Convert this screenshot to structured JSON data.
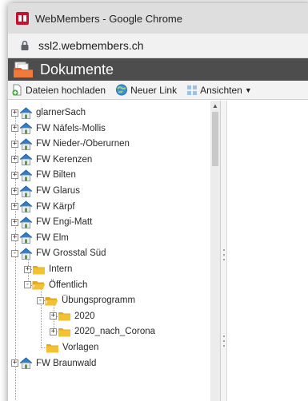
{
  "browser": {
    "window_title": "WebMembers - Google Chrome",
    "url": "ssl2.webmembers.ch"
  },
  "page": {
    "heading": "Dokumente"
  },
  "toolbar": {
    "upload_label": "Dateien hochladen",
    "new_link_label": "Neuer Link",
    "views_label": "Ansichten"
  },
  "tree": {
    "items": [
      {
        "label": "glarnerSach",
        "type": "house",
        "expander": "+"
      },
      {
        "label": "FW Näfels-Mollis",
        "type": "house",
        "expander": "+"
      },
      {
        "label": "FW Nieder-/Oberurnen",
        "type": "house",
        "expander": "+"
      },
      {
        "label": "FW Kerenzen",
        "type": "house",
        "expander": "+"
      },
      {
        "label": "FW Bilten",
        "type": "house",
        "expander": "+"
      },
      {
        "label": "FW Glarus",
        "type": "house",
        "expander": "+"
      },
      {
        "label": "FW Kärpf",
        "type": "house",
        "expander": "+"
      },
      {
        "label": "FW Engi-Matt",
        "type": "house",
        "expander": "+"
      },
      {
        "label": "FW Elm",
        "type": "house",
        "expander": "+"
      },
      {
        "label": "FW Grosstal Süd",
        "type": "house",
        "expander": "-"
      },
      {
        "label": "Intern",
        "type": "folder",
        "expander": "+"
      },
      {
        "label": "Öffentlich",
        "type": "folder-open",
        "expander": "-"
      },
      {
        "label": "Übungsprogramm",
        "type": "folder-open",
        "expander": "-"
      },
      {
        "label": "2020",
        "type": "folder",
        "expander": "+"
      },
      {
        "label": "2020_nach_Corona",
        "type": "folder",
        "expander": "+"
      },
      {
        "label": "Vorlagen",
        "type": "folder",
        "expander": ""
      },
      {
        "label": "FW Braunwald",
        "type": "house",
        "expander": "+"
      }
    ]
  },
  "colors": {
    "heading_bg": "#4d4d4d",
    "folder": "#f2c230",
    "house_roof": "#2f7fd0"
  }
}
